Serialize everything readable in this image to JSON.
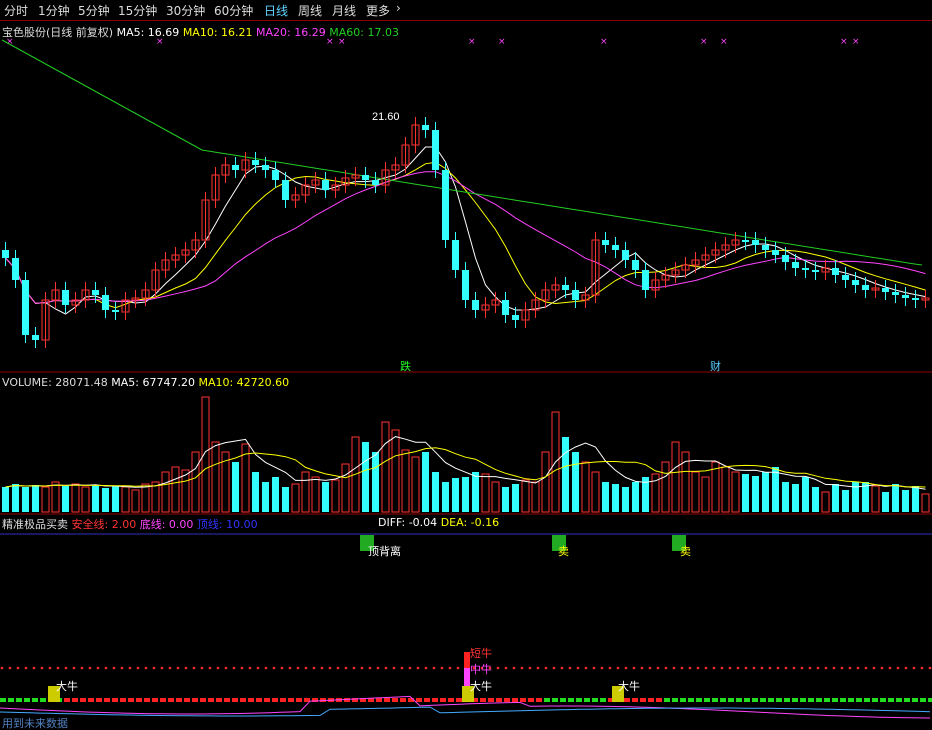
{
  "toolbar": {
    "tabs": [
      "分时",
      "1分钟",
      "5分钟",
      "15分钟",
      "30分钟",
      "60分钟",
      "日线",
      "周线",
      "月线",
      "更多"
    ],
    "active": "日线",
    "more_icon": "chevron-right-icon"
  },
  "price_panel": {
    "stock_label": "宝色股份(日线 前复权)",
    "ma5": "MA5: 16.69",
    "ma10": "MA10: 16.21",
    "ma20": "MA20: 16.29",
    "ma60": "MA60: 17.03",
    "high_marker": "21.60",
    "markers": [
      "跌",
      "财"
    ],
    "colors": {
      "ma5": "#ffffff",
      "ma10": "#ffff00",
      "ma20": "#ff44ff",
      "ma60": "#22cc22",
      "up": "#ff3333",
      "down": "#33ffff"
    }
  },
  "volume_panel": {
    "label": "VOLUME: 28071.48",
    "ma5": "MA5: 67747.20",
    "ma10": "MA10: 42720.60"
  },
  "indicator_panel": {
    "name": "精准极品买卖",
    "safe": "安全线: 2.00",
    "bottom": "底线: 0.00",
    "top": "顶线: 10.00",
    "diff": "DIFF: -0.04",
    "dea": "DEA: -0.16",
    "signals": [
      "顶背离",
      "卖",
      "卖"
    ],
    "bull_labels": [
      "大牛",
      "大牛",
      "大牛",
      "中牛",
      "短牛"
    ],
    "footer": "用到未来数据"
  }
}
